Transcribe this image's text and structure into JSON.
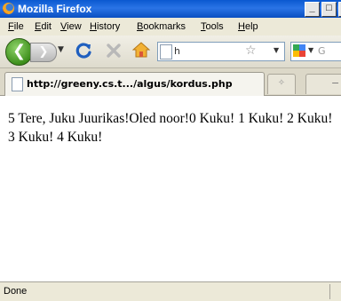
{
  "window": {
    "title": "Mozilla Firefox",
    "controls": [
      "_",
      "□",
      "X"
    ]
  },
  "menubar": {
    "items": [
      "File",
      "Edit",
      "View",
      "History",
      "Bookmarks",
      "Tools",
      "Help"
    ]
  },
  "navbar": {
    "back_icon": "back-arrow-icon",
    "forward_icon": "forward-arrow-icon",
    "url_text": "h",
    "search_text": "G"
  },
  "tabs": [
    {
      "label": "http://greeny.cs.t.../algus/kordus.php",
      "active": true
    }
  ],
  "content": {
    "text": "5 Tere, Juku Juurikas!Oled noor!0 Kuku! 1 Kuku! 2 Kuku! 3 Kuku! 4 Kuku!"
  },
  "statusbar": {
    "text": "Done"
  },
  "colors": {
    "titlebar": "#0a58d0",
    "chrome": "#ece9d8",
    "back_button": "#3d8f1b"
  }
}
